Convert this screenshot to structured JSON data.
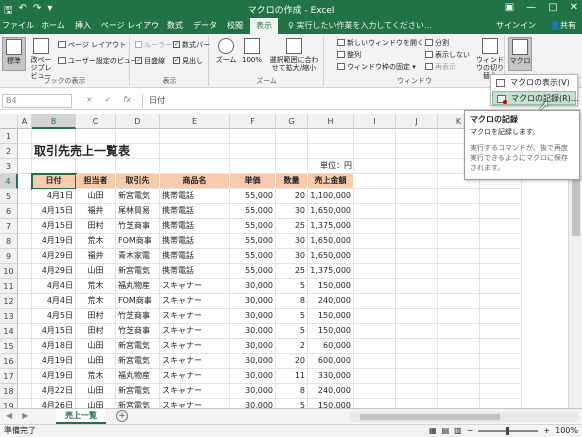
{
  "window": {
    "title": "マクロの作成 - Excel"
  },
  "tabs": [
    {
      "label": "ファイル"
    },
    {
      "label": "ホーム"
    },
    {
      "label": "挿入"
    },
    {
      "label": "ページ レイアウト"
    },
    {
      "label": "数式"
    },
    {
      "label": "データ"
    },
    {
      "label": "校閲"
    },
    {
      "label": "表示"
    }
  ],
  "active_tab": "表示",
  "tell_me": "実行したい作業を入力してください...",
  "account": {
    "signin": "サインイン",
    "share": "共有"
  },
  "ribbon": {
    "book_views": {
      "label": "ブックの表示",
      "normal": "標準",
      "page_break": "改ページプレビュー",
      "page_layout": "ページ レイアウト",
      "custom_views": "ユーザー設定のビュー"
    },
    "show": {
      "label": "表示",
      "ruler": "ルーラー",
      "formula_bar": "数式バー",
      "gridlines": "目盛線",
      "headings": "見出し"
    },
    "zoom": {
      "label": "ズーム",
      "zoom": "ズーム",
      "hundred": "100%",
      "zoom_selection": "選択範囲に合わせて拡大/縮小"
    },
    "window": {
      "label": "ウィンドウ",
      "new_window": "新しいウィンドウを開く",
      "arrange": "整列",
      "freeze": "ウィンドウ枠の固定",
      "split": "分割",
      "hide": "表示しない",
      "unhide": "再表示",
      "switch": "ウィンドウの切り替え"
    },
    "macros": {
      "label": "マクロ"
    }
  },
  "macro_menu": {
    "items": [
      {
        "label": "マクロの表示(V)"
      },
      {
        "label": "マクロの記録(R)..."
      }
    ]
  },
  "tooltip": {
    "title": "マクロの記録",
    "desc": "マクロを記録します。",
    "note": "実行するコマンドが、後で再度実行できるようにマクロに保存されます。"
  },
  "formula_bar": {
    "name_box": "B4",
    "cancel": "×",
    "enter": "✓",
    "fx": "fx",
    "content": "日付"
  },
  "columns": [
    "A",
    "B",
    "C",
    "D",
    "E",
    "F",
    "G",
    "H",
    "I",
    "J",
    "K",
    "L"
  ],
  "rows": [
    "1",
    "2",
    "3",
    "4",
    "5",
    "6",
    "7",
    "8",
    "9",
    "10",
    "11",
    "12",
    "13",
    "14",
    "15",
    "16",
    "17",
    "18",
    "19"
  ],
  "sheet": {
    "title": "取引先売上一覧表",
    "unit": "単位：円",
    "headers": [
      "日付",
      "担当者",
      "取引先",
      "商品名",
      "単価",
      "数量",
      "売上金額"
    ],
    "data": [
      [
        "4月1日",
        "山田",
        "新宮電気",
        "携帯電話",
        "55,000",
        "20",
        "1,100,000"
      ],
      [
        "4月15日",
        "福井",
        "尾林貿易",
        "携帯電話",
        "55,000",
        "30",
        "1,650,000"
      ],
      [
        "4月15日",
        "田村",
        "竹芝商事",
        "携帯電話",
        "55,000",
        "25",
        "1,375,000"
      ],
      [
        "4月19日",
        "荒木",
        "FOM商事",
        "携帯電話",
        "55,000",
        "30",
        "1,650,000"
      ],
      [
        "4月29日",
        "福井",
        "青木家電",
        "携帯電話",
        "55,000",
        "30",
        "1,650,000"
      ],
      [
        "4月29日",
        "山田",
        "新宮電気",
        "携帯電話",
        "55,000",
        "25",
        "1,375,000"
      ],
      [
        "4月4日",
        "荒木",
        "福丸物産",
        "スキャナー",
        "30,000",
        "5",
        "150,000"
      ],
      [
        "4月4日",
        "荒木",
        "FOM商事",
        "スキャナー",
        "30,000",
        "8",
        "240,000"
      ],
      [
        "4月5日",
        "田村",
        "竹芝商事",
        "スキャナー",
        "30,000",
        "5",
        "150,000"
      ],
      [
        "4月15日",
        "田村",
        "竹芝商事",
        "スキャナー",
        "30,000",
        "5",
        "150,000"
      ],
      [
        "4月18日",
        "山田",
        "新宮電気",
        "スキャナー",
        "30,000",
        "2",
        "60,000"
      ],
      [
        "4月19日",
        "山田",
        "新宮電気",
        "スキャナー",
        "30,000",
        "20",
        "600,000"
      ],
      [
        "4月19日",
        "荒木",
        "福丸物産",
        "スキャナー",
        "30,000",
        "11",
        "330,000"
      ],
      [
        "4月22日",
        "山田",
        "新宮電気",
        "スキャナー",
        "30,000",
        "8",
        "240,000"
      ],
      [
        "4月26日",
        "山田",
        "新宮電気",
        "スキャナー",
        "30,000",
        "5",
        "150,000"
      ]
    ]
  },
  "sheet_tab": "売上一覧",
  "status": {
    "ready": "準備完了",
    "zoom": "100%"
  }
}
